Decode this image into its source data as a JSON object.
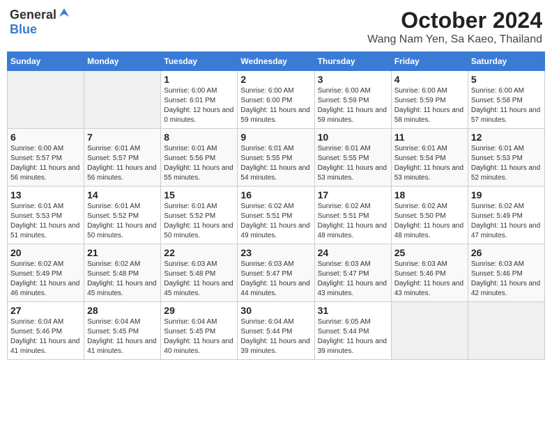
{
  "header": {
    "logo_general": "General",
    "logo_blue": "Blue",
    "month": "October 2024",
    "location": "Wang Nam Yen, Sa Kaeo, Thailand"
  },
  "days_of_week": [
    "Sunday",
    "Monday",
    "Tuesday",
    "Wednesday",
    "Thursday",
    "Friday",
    "Saturday"
  ],
  "weeks": [
    [
      {
        "day": "",
        "empty": true
      },
      {
        "day": "",
        "empty": true
      },
      {
        "day": "1",
        "sunrise": "Sunrise: 6:00 AM",
        "sunset": "Sunset: 6:01 PM",
        "daylight": "Daylight: 12 hours and 0 minutes."
      },
      {
        "day": "2",
        "sunrise": "Sunrise: 6:00 AM",
        "sunset": "Sunset: 6:00 PM",
        "daylight": "Daylight: 11 hours and 59 minutes."
      },
      {
        "day": "3",
        "sunrise": "Sunrise: 6:00 AM",
        "sunset": "Sunset: 5:59 PM",
        "daylight": "Daylight: 11 hours and 59 minutes."
      },
      {
        "day": "4",
        "sunrise": "Sunrise: 6:00 AM",
        "sunset": "Sunset: 5:59 PM",
        "daylight": "Daylight: 11 hours and 58 minutes."
      },
      {
        "day": "5",
        "sunrise": "Sunrise: 6:00 AM",
        "sunset": "Sunset: 5:58 PM",
        "daylight": "Daylight: 11 hours and 57 minutes."
      }
    ],
    [
      {
        "day": "6",
        "sunrise": "Sunrise: 6:00 AM",
        "sunset": "Sunset: 5:57 PM",
        "daylight": "Daylight: 11 hours and 56 minutes."
      },
      {
        "day": "7",
        "sunrise": "Sunrise: 6:01 AM",
        "sunset": "Sunset: 5:57 PM",
        "daylight": "Daylight: 11 hours and 56 minutes."
      },
      {
        "day": "8",
        "sunrise": "Sunrise: 6:01 AM",
        "sunset": "Sunset: 5:56 PM",
        "daylight": "Daylight: 11 hours and 55 minutes."
      },
      {
        "day": "9",
        "sunrise": "Sunrise: 6:01 AM",
        "sunset": "Sunset: 5:55 PM",
        "daylight": "Daylight: 11 hours and 54 minutes."
      },
      {
        "day": "10",
        "sunrise": "Sunrise: 6:01 AM",
        "sunset": "Sunset: 5:55 PM",
        "daylight": "Daylight: 11 hours and 53 minutes."
      },
      {
        "day": "11",
        "sunrise": "Sunrise: 6:01 AM",
        "sunset": "Sunset: 5:54 PM",
        "daylight": "Daylight: 11 hours and 53 minutes."
      },
      {
        "day": "12",
        "sunrise": "Sunrise: 6:01 AM",
        "sunset": "Sunset: 5:53 PM",
        "daylight": "Daylight: 11 hours and 52 minutes."
      }
    ],
    [
      {
        "day": "13",
        "sunrise": "Sunrise: 6:01 AM",
        "sunset": "Sunset: 5:53 PM",
        "daylight": "Daylight: 11 hours and 51 minutes."
      },
      {
        "day": "14",
        "sunrise": "Sunrise: 6:01 AM",
        "sunset": "Sunset: 5:52 PM",
        "daylight": "Daylight: 11 hours and 50 minutes."
      },
      {
        "day": "15",
        "sunrise": "Sunrise: 6:01 AM",
        "sunset": "Sunset: 5:52 PM",
        "daylight": "Daylight: 11 hours and 50 minutes."
      },
      {
        "day": "16",
        "sunrise": "Sunrise: 6:02 AM",
        "sunset": "Sunset: 5:51 PM",
        "daylight": "Daylight: 11 hours and 49 minutes."
      },
      {
        "day": "17",
        "sunrise": "Sunrise: 6:02 AM",
        "sunset": "Sunset: 5:51 PM",
        "daylight": "Daylight: 11 hours and 48 minutes."
      },
      {
        "day": "18",
        "sunrise": "Sunrise: 6:02 AM",
        "sunset": "Sunset: 5:50 PM",
        "daylight": "Daylight: 11 hours and 48 minutes."
      },
      {
        "day": "19",
        "sunrise": "Sunrise: 6:02 AM",
        "sunset": "Sunset: 5:49 PM",
        "daylight": "Daylight: 11 hours and 47 minutes."
      }
    ],
    [
      {
        "day": "20",
        "sunrise": "Sunrise: 6:02 AM",
        "sunset": "Sunset: 5:49 PM",
        "daylight": "Daylight: 11 hours and 46 minutes."
      },
      {
        "day": "21",
        "sunrise": "Sunrise: 6:02 AM",
        "sunset": "Sunset: 5:48 PM",
        "daylight": "Daylight: 11 hours and 45 minutes."
      },
      {
        "day": "22",
        "sunrise": "Sunrise: 6:03 AM",
        "sunset": "Sunset: 5:48 PM",
        "daylight": "Daylight: 11 hours and 45 minutes."
      },
      {
        "day": "23",
        "sunrise": "Sunrise: 6:03 AM",
        "sunset": "Sunset: 5:47 PM",
        "daylight": "Daylight: 11 hours and 44 minutes."
      },
      {
        "day": "24",
        "sunrise": "Sunrise: 6:03 AM",
        "sunset": "Sunset: 5:47 PM",
        "daylight": "Daylight: 11 hours and 43 minutes."
      },
      {
        "day": "25",
        "sunrise": "Sunrise: 6:03 AM",
        "sunset": "Sunset: 5:46 PM",
        "daylight": "Daylight: 11 hours and 43 minutes."
      },
      {
        "day": "26",
        "sunrise": "Sunrise: 6:03 AM",
        "sunset": "Sunset: 5:46 PM",
        "daylight": "Daylight: 11 hours and 42 minutes."
      }
    ],
    [
      {
        "day": "27",
        "sunrise": "Sunrise: 6:04 AM",
        "sunset": "Sunset: 5:46 PM",
        "daylight": "Daylight: 11 hours and 41 minutes."
      },
      {
        "day": "28",
        "sunrise": "Sunrise: 6:04 AM",
        "sunset": "Sunset: 5:45 PM",
        "daylight": "Daylight: 11 hours and 41 minutes."
      },
      {
        "day": "29",
        "sunrise": "Sunrise: 6:04 AM",
        "sunset": "Sunset: 5:45 PM",
        "daylight": "Daylight: 11 hours and 40 minutes."
      },
      {
        "day": "30",
        "sunrise": "Sunrise: 6:04 AM",
        "sunset": "Sunset: 5:44 PM",
        "daylight": "Daylight: 11 hours and 39 minutes."
      },
      {
        "day": "31",
        "sunrise": "Sunrise: 6:05 AM",
        "sunset": "Sunset: 5:44 PM",
        "daylight": "Daylight: 11 hours and 39 minutes."
      },
      {
        "day": "",
        "empty": true
      },
      {
        "day": "",
        "empty": true
      }
    ]
  ]
}
